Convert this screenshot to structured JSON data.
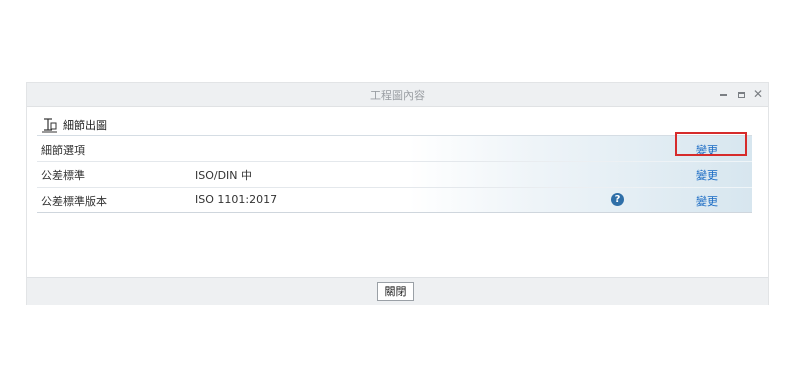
{
  "window": {
    "title": "工程圖內容"
  },
  "section": {
    "title": "細節出圖",
    "icon": "detailing-icon"
  },
  "rows": [
    {
      "label": "細節選項",
      "value": "",
      "action": "變更",
      "info": false
    },
    {
      "label": "公差標準",
      "value": "ISO/DIN 中",
      "action": "變更",
      "info": false
    },
    {
      "label": "公差標準版本",
      "value": "ISO 1101:2017",
      "action": "變更",
      "info": true
    }
  ],
  "info_icon_glyph": "?",
  "footer": {
    "close_label": "關閉"
  },
  "colors": {
    "highlight": "#d62b2b",
    "link": "#1a6bc4"
  }
}
